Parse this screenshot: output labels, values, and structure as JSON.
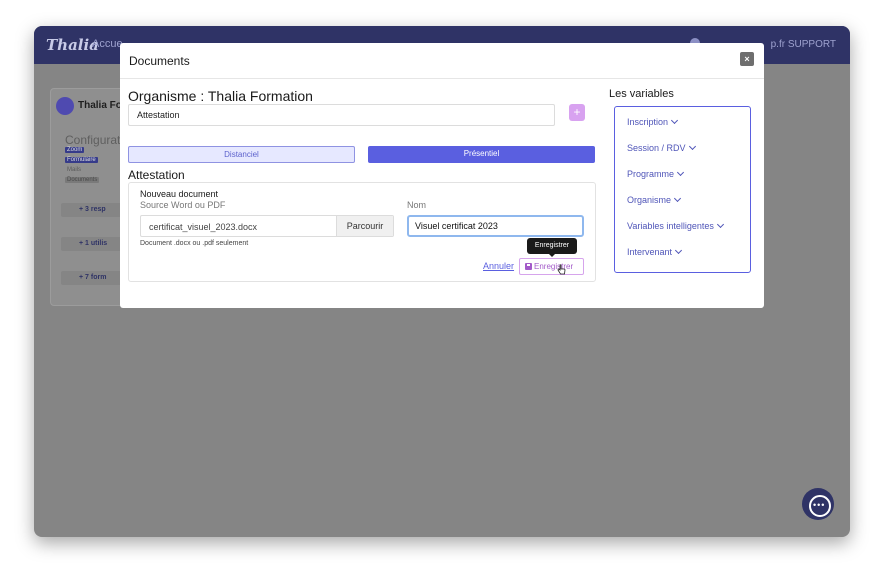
{
  "background": {
    "logo": "Thalia",
    "nav_text": "Accue",
    "support_label": "p.fr SUPPORT",
    "org_name": "Thalia For",
    "config_label": "Configurat",
    "tags": [
      "Zoom",
      "Formulaire",
      "Mails",
      "Documents"
    ],
    "rows": [
      "+ 3 resp",
      "+ 1 utilis",
      "+ 7 form"
    ]
  },
  "modal": {
    "title": "Documents",
    "close_label": "×",
    "org_title": "Organisme : Thalia Formation",
    "name_value": "Attestation",
    "plus_label": "+",
    "tabs": {
      "distanciel": "Distanciel",
      "presentiel": "Présentiel"
    },
    "section_title": "Attestation",
    "doc": {
      "new_label": "Nouveau document",
      "source_label": "Source Word ou PDF",
      "nom_label": "Nom",
      "file_name": "certificat_visuel_2023.docx",
      "browse_label": "Parcourir",
      "nom_value": "Visuel certificat 2023",
      "hint": "Document .docx ou .pdf seulement",
      "cancel_label": "Annuler",
      "save_label": "Enregistrer",
      "tooltip": "Enregistrer"
    },
    "vars_title": "Les variables",
    "variables": [
      "Inscription",
      "Session / RDV",
      "Programme",
      "Organisme",
      "Variables intelligentes",
      "Intervenant"
    ]
  },
  "chat_dots": "•••"
}
